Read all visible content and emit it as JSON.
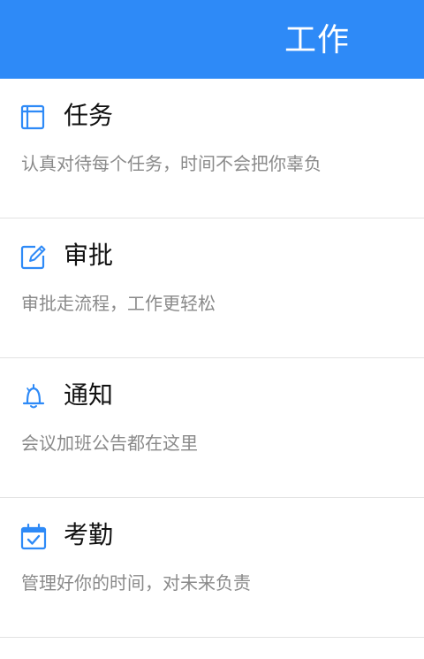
{
  "header": {
    "title": "工作",
    "color": "#2e8af7"
  },
  "items": [
    {
      "title": "任务",
      "desc": "认真对待每个任务，时间不会把你辜负",
      "icon": "task-icon"
    },
    {
      "title": "审批",
      "desc": "审批走流程，工作更轻松",
      "icon": "approval-edit-icon"
    },
    {
      "title": "通知",
      "desc": "会议加班公告都在这里",
      "icon": "bell-icon"
    },
    {
      "title": "考勤",
      "desc": "管理好你的时间，对未来负责",
      "icon": "calendar-check-icon"
    }
  ],
  "accent_color": "#2e8af7"
}
